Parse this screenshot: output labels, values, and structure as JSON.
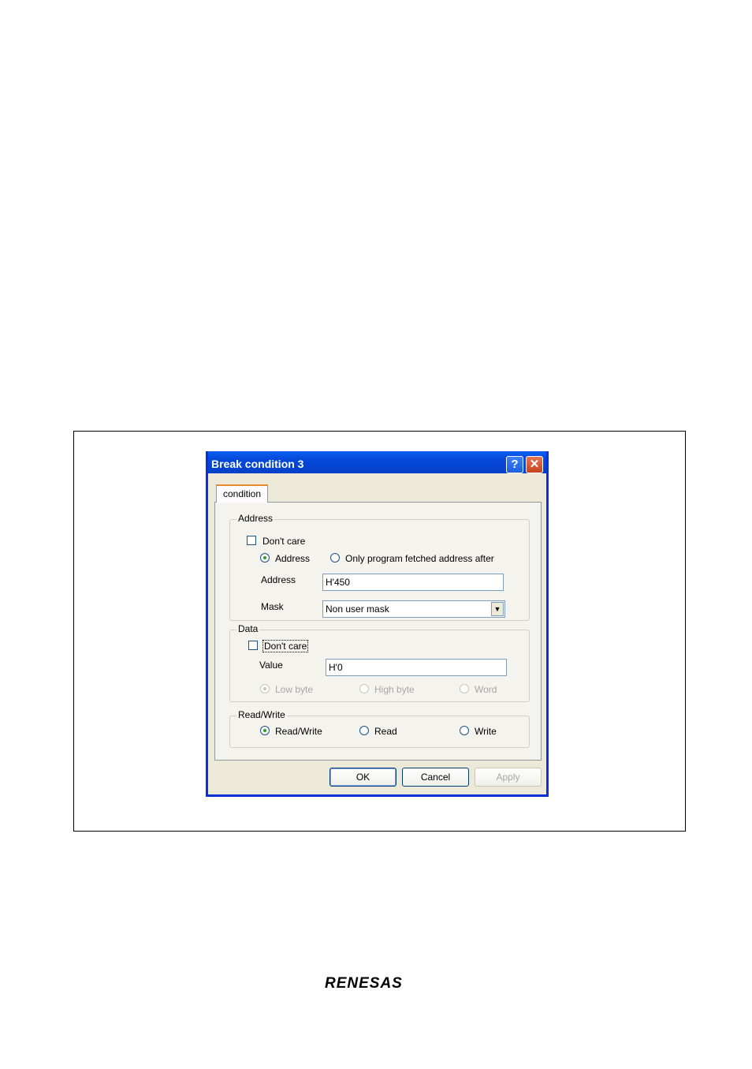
{
  "dialog": {
    "title": "Break condition 3",
    "help_glyph": "?",
    "close_glyph": "✕",
    "tab_label": "condition",
    "address_group": {
      "legend": "Address",
      "dont_care_label": "Don't care",
      "dont_care_checked": false,
      "radio_address_label": "Address",
      "radio_address_selected": true,
      "radio_fetched_label": "Only program fetched address after",
      "radio_fetched_selected": false,
      "address_label": "Address",
      "address_value": "H'450",
      "mask_label": "Mask",
      "mask_value": "Non user mask"
    },
    "data_group": {
      "legend": "Data",
      "dont_care_label": "Don't care",
      "dont_care_checked": false,
      "value_label": "Value",
      "value_value": "H'0",
      "low_byte_label": "Low byte",
      "high_byte_label": "High byte",
      "word_label": "Word",
      "selected": "Low byte"
    },
    "rw_group": {
      "legend": "Read/Write",
      "read_write_label": "Read/Write",
      "read_label": "Read",
      "write_label": "Write",
      "selected": "Read/Write"
    },
    "buttons": {
      "ok": "OK",
      "cancel": "Cancel",
      "apply": "Apply"
    }
  },
  "footer": {
    "logo_text": "RENESAS"
  },
  "colors": {
    "titlebar": "#0548d8",
    "dialog_bg": "#ece9d8",
    "radio_dot": "#21a121"
  }
}
